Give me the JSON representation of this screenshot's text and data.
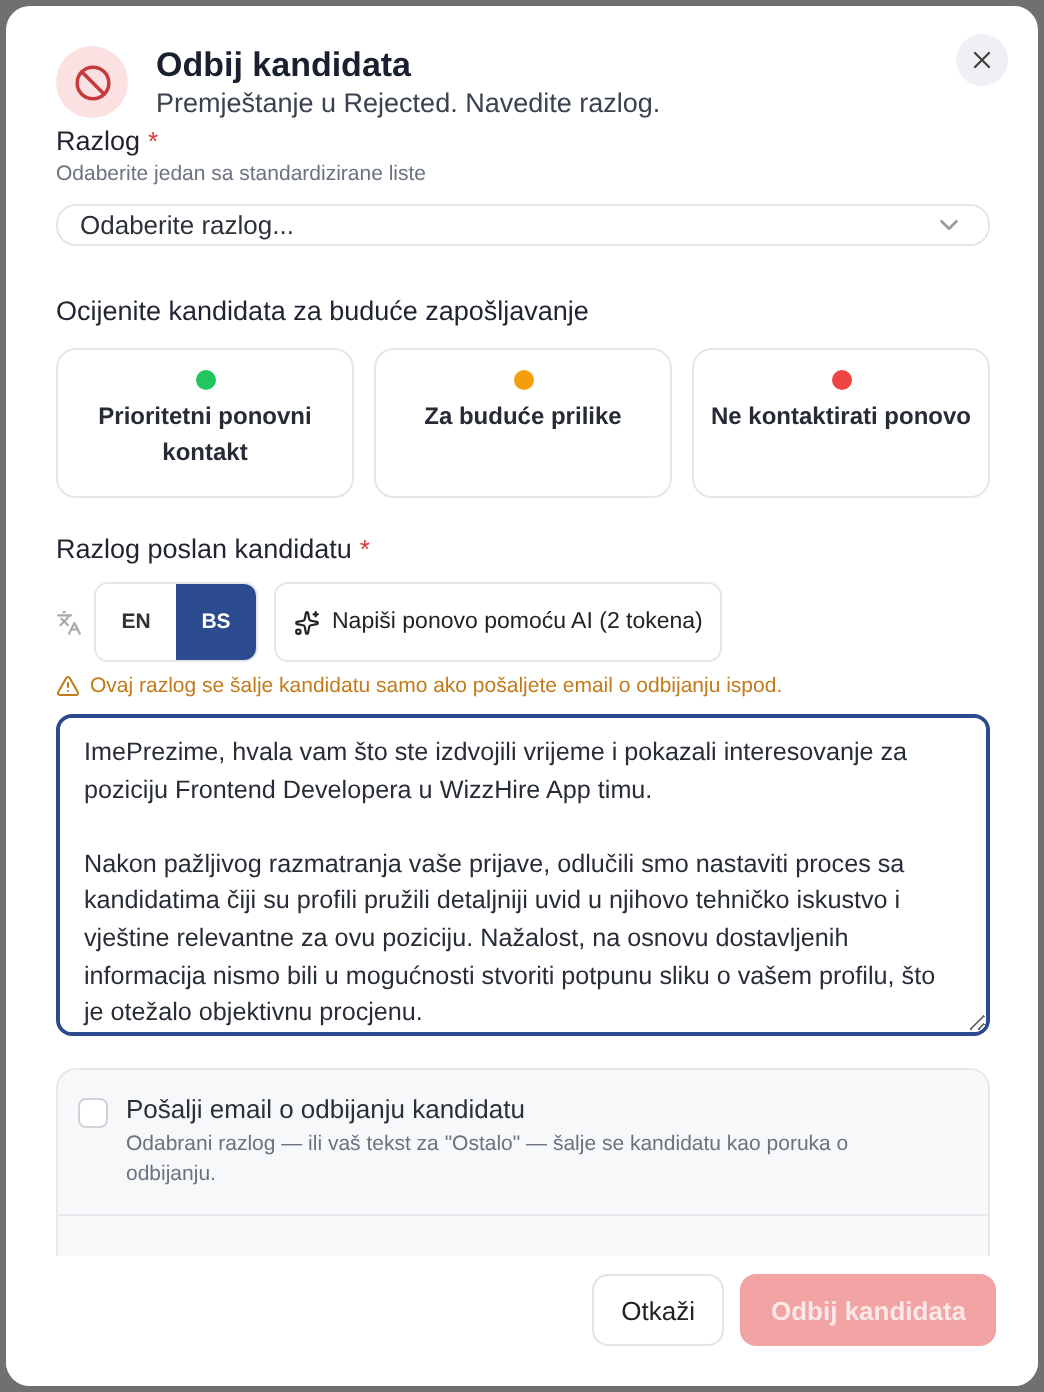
{
  "dialog": {
    "title": "Odbij kandidata",
    "subtitle": "Premještanje u Rejected. Navedite razlog."
  },
  "reason": {
    "label": "Razlog",
    "required_mark": "*",
    "hint": "Odaberite jedan sa standardizirane liste",
    "placeholder": "Odaberite razlog..."
  },
  "rating": {
    "label": "Ocijenite kandidata za buduće zapošljavanje",
    "options": [
      {
        "label": "Prioritetni ponovni kontakt",
        "color": "#22c55e",
        "selected": false
      },
      {
        "label": "Za buduće prilike",
        "color": "#f59e0b",
        "selected": false
      },
      {
        "label": "Ne kontaktirati ponovo",
        "color": "#ef4444",
        "selected": false
      }
    ]
  },
  "message": {
    "label": "Razlog poslan kandidatu",
    "required_mark": "*",
    "languages": [
      {
        "label": "EN",
        "selected": false
      },
      {
        "label": "BS",
        "selected": true
      }
    ],
    "ai_button": "Napiši ponovo pomoću AI (2 tokena)",
    "warning": "Ovaj razlog se šalje kandidatu samo ako pošaljete email o odbijanju ispod.",
    "text": "ImePrezime, hvala vam što ste izdvojili vrijeme i pokazali interesovanje za poziciju Frontend Developera u WizzHire App timu.\n\nNakon pažljivog razmatranja vaše prijave, odlučili smo nastaviti proces sa kandidatima čiji su profili pružili detaljniji uvid u njihovo tehničko iskustvo i vještine relevantne za ovu poziciju. Nažalost, na osnovu dostavljenih informacija nismo bili u mogućnosti stvoriti potpunu sliku o vašem profilu, što je otežalo objektivnu procjenu."
  },
  "email": {
    "label": "Pošalji email o odbijanju kandidatu",
    "hint": "Odabrani razlog — ili vaš tekst za \"Ostalo\" — šalje se kandidatu kao poruka o odbijanju.",
    "checked": false
  },
  "buttons": {
    "cancel": "Otkaži",
    "confirm": "Odbij kandidata",
    "confirm_disabled": true
  }
}
